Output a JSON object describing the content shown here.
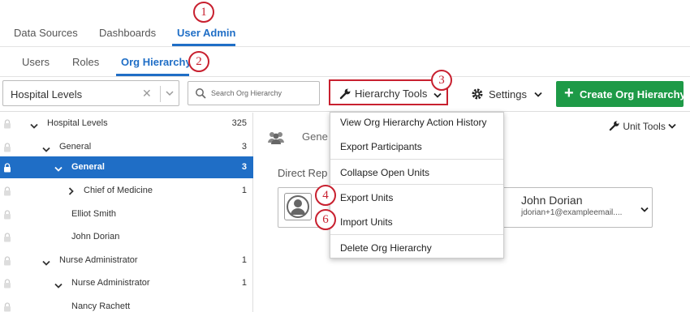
{
  "nav": {
    "tabs": [
      "Data Sources",
      "Dashboards",
      "User Admin"
    ],
    "subtabs": [
      "Users",
      "Roles",
      "Org Hierarchy"
    ]
  },
  "badges": [
    "1",
    "2",
    "3",
    "4",
    "6"
  ],
  "toolbar": {
    "hierarchy_select": "Hospital Levels",
    "search_placeholder": "Search Org Hierarchy",
    "hierarchy_tools": "Hierarchy Tools",
    "settings": "Settings",
    "create": "Create Org Hierarchy"
  },
  "tree": [
    {
      "label": "Hospital Levels",
      "count": "325"
    },
    {
      "label": "General",
      "count": "3"
    },
    {
      "label": "General",
      "count": "3"
    },
    {
      "label": "Chief of Medicine",
      "count": "1"
    },
    {
      "label": "Elliot Smith",
      "count": ""
    },
    {
      "label": "John Dorian",
      "count": ""
    },
    {
      "label": "Nurse Administrator",
      "count": "1"
    },
    {
      "label": "Nurse Administrator",
      "count": "1"
    },
    {
      "label": "Nancy Rachett",
      "count": ""
    }
  ],
  "panel": {
    "unit_title": "Gene",
    "unit_tools": "Unit Tools",
    "direct_label": "Direct Rep",
    "person_name": "John Dorian",
    "person_email": "jdorian+1@exampleemail...."
  },
  "menu": [
    "View Org Hierarchy Action History",
    "Export Participants",
    "Collapse Open Units",
    "Export Units",
    "Import Units",
    "Delete Org Hierarchy"
  ],
  "colors": {
    "accent": "#1f6ec6",
    "create_green": "#1e9a47",
    "callout_red": "#c8202f"
  }
}
